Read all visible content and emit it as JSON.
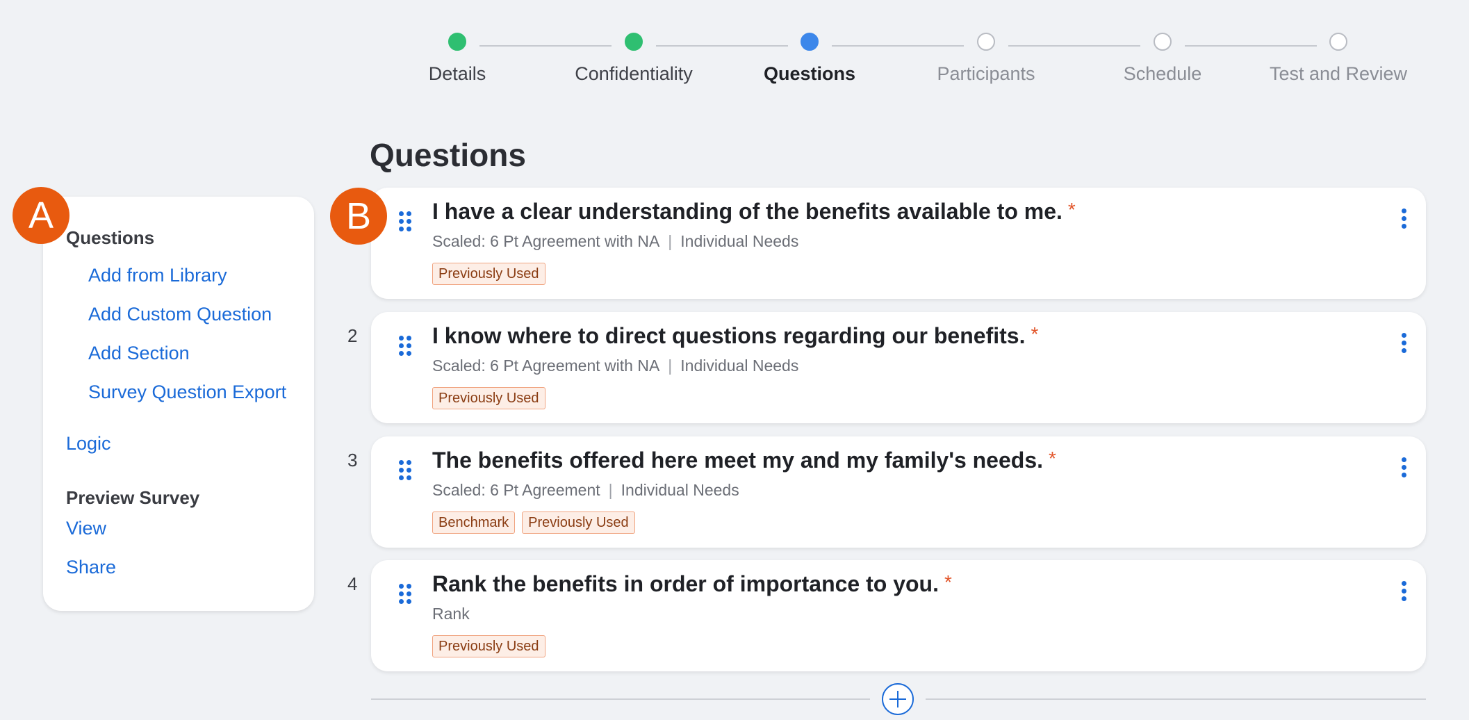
{
  "stepper": {
    "steps": [
      {
        "label": "Details",
        "state": "done"
      },
      {
        "label": "Confidentiality",
        "state": "done"
      },
      {
        "label": "Questions",
        "state": "current"
      },
      {
        "label": "Participants",
        "state": "upcoming"
      },
      {
        "label": "Schedule",
        "state": "upcoming"
      },
      {
        "label": "Test and Review",
        "state": "upcoming"
      }
    ]
  },
  "page_title": "Questions",
  "callouts": {
    "a": "A",
    "b": "B"
  },
  "sidebar": {
    "questions_heading": "Questions",
    "question_links": [
      "Add from Library",
      "Add Custom Question",
      "Add Section",
      "Survey Question Export"
    ],
    "logic_link": "Logic",
    "preview_heading": "Preview Survey",
    "preview_links": [
      "View",
      "Share"
    ]
  },
  "questions": [
    {
      "number": "",
      "title": "I have a clear understanding of the benefits available to me.",
      "required": "*",
      "meta": [
        "Scaled: 6 Pt Agreement with NA",
        "Individual Needs"
      ],
      "tags": [
        "Previously Used"
      ]
    },
    {
      "number": "2",
      "title": "I know where to direct questions regarding our benefits.",
      "required": "*",
      "meta": [
        "Scaled: 6 Pt Agreement with NA",
        "Individual Needs"
      ],
      "tags": [
        "Previously Used"
      ]
    },
    {
      "number": "3",
      "title": "The benefits offered here meet my and my family's needs.",
      "required": "*",
      "meta": [
        "Scaled: 6 Pt Agreement",
        "Individual Needs"
      ],
      "tags": [
        "Benchmark",
        "Previously Used"
      ]
    },
    {
      "number": "4",
      "title": "Rank the benefits in order of importance to you.",
      "required": "*",
      "meta": [
        "Rank"
      ],
      "tags": [
        "Previously Used"
      ]
    }
  ],
  "colors": {
    "accent": "#1a6ad8",
    "done": "#2fbf71",
    "current": "#3c87ea",
    "callout": "#e85a0f",
    "required": "#e2562b"
  },
  "icons": {
    "drag": "drag-handle-icon",
    "more": "kebab-menu-icon",
    "add": "plus-circle-icon"
  }
}
